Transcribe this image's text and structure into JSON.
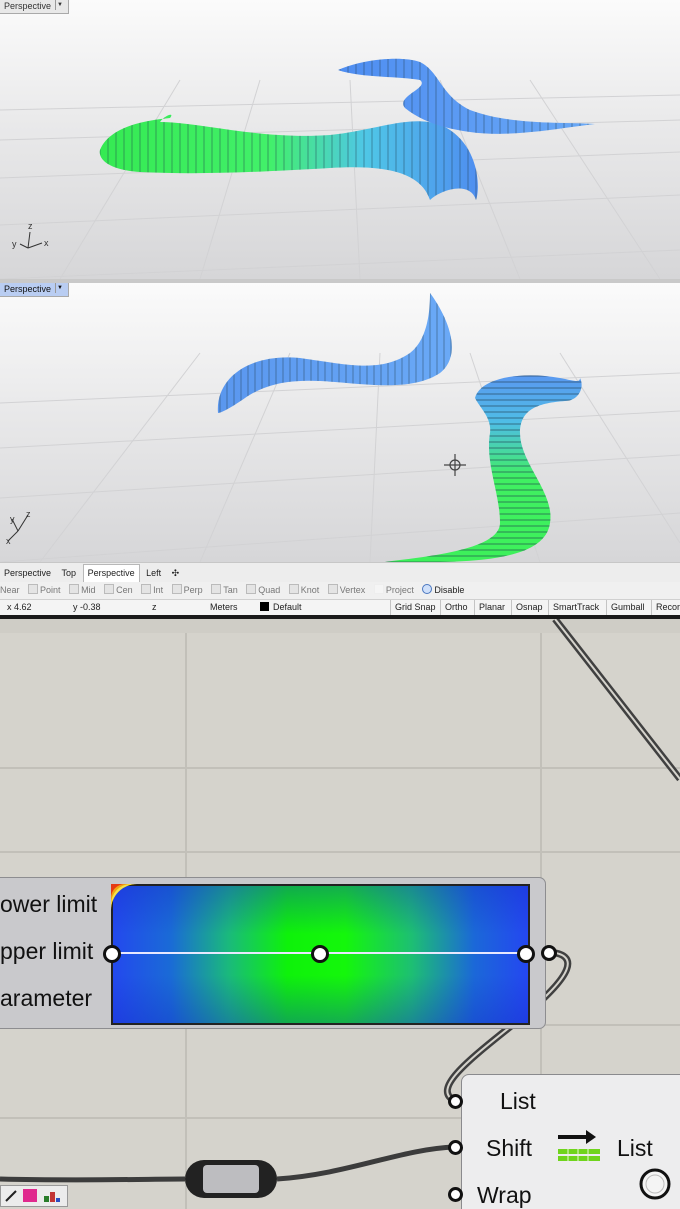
{
  "viewport_top": {
    "label": "Perspective",
    "active": false
  },
  "viewport_bottom": {
    "label": "Perspective",
    "active": true
  },
  "view_tabs": [
    "Perspective",
    "Top",
    "Perspective",
    "Left"
  ],
  "osnap": {
    "items": [
      "Near",
      "Point",
      "Mid",
      "Cen",
      "Int",
      "Perp",
      "Tan",
      "Quad",
      "Knot",
      "Vertex",
      "Project"
    ],
    "disable_label": "Disable"
  },
  "status_bar": {
    "x": "x 4.62",
    "y": "y -0.38",
    "z": "z",
    "units": "Meters",
    "layer": "Default",
    "buttons": [
      "Grid Snap",
      "Ortho",
      "Planar",
      "Osnap",
      "SmartTrack",
      "Gumball",
      "Recor"
    ]
  },
  "axes": {
    "x": "x",
    "y": "y",
    "z": "z"
  },
  "gradient_component": {
    "inputs": [
      "ower limit",
      "pper limit",
      "arameter"
    ],
    "colors": [
      "#2349ee",
      "#0ef20a",
      "#2349ee"
    ]
  },
  "shift_component": {
    "inputs": [
      "List",
      "Shift",
      "Wrap"
    ],
    "output": "List"
  },
  "colors": {
    "canvas": "#d5d3cc",
    "wire": "#4a4a4a",
    "surface_blue": "#5b9bf0",
    "surface_green": "#3ef05a"
  }
}
